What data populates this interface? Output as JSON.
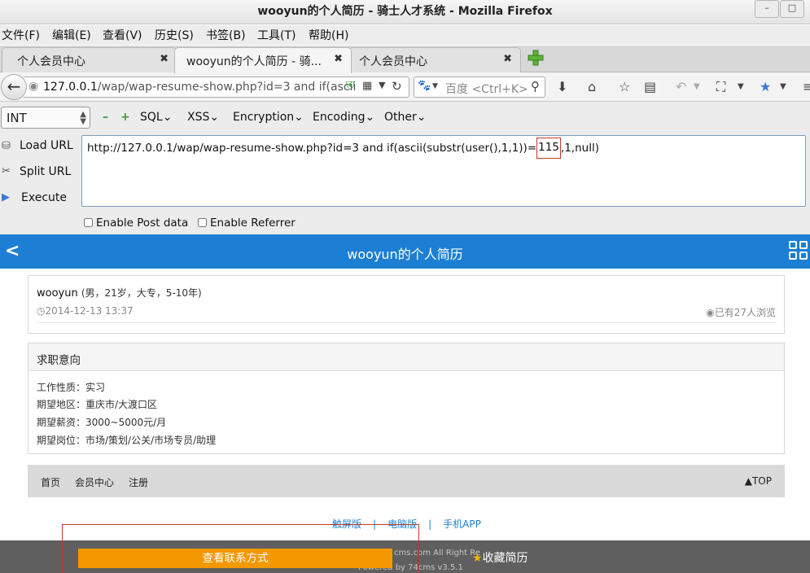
{
  "window": {
    "title": "wooyun的个人简历 - 骑士人才系统 - Mozilla Firefox",
    "minimize": "–",
    "maximize": "□"
  },
  "menu": [
    "文件(F)",
    "编辑(E)",
    "查看(V)",
    "历史(S)",
    "书签(B)",
    "工具(T)",
    "帮助(H)"
  ],
  "tabs": [
    {
      "label": "个人会员中心",
      "close": "✖"
    },
    {
      "label": "wooyun的个人简历 - 骑...",
      "close": "✖"
    },
    {
      "label": "个人会员中心",
      "close": "✖"
    }
  ],
  "nav": {
    "url_host": "127.0.0.1",
    "url_path": "/wap/wap-resume-show.php?id=3 and if(ascii",
    "search_placeholder": "百度 <Ctrl+K>"
  },
  "hackbar": {
    "select_value": "INT",
    "minus": "–",
    "plus": "+",
    "menus": [
      "SQL",
      "XSS",
      "Encryption",
      "Encoding",
      "Other"
    ],
    "load_url": "Load URL",
    "split_url": "Split URL",
    "execute": "Execute",
    "url_before": "http://127.0.0.1/wap/wap-resume-show.php?id=3 and if(ascii(substr(user(),1,1))=",
    "url_highlight": "115",
    "url_after": ",1,null)",
    "enable_post": "Enable Post data",
    "enable_referrer": "Enable Referrer"
  },
  "page": {
    "header_title": "wooyun的个人简历",
    "name": "wooyun",
    "details": "(男，21岁，大专，5-10年)",
    "date": "2014-12-13 13:37",
    "views": "已有27人浏览",
    "section_title": "求职意向",
    "rows": [
      "工作性质：实习",
      "期望地区：重庆市/大渡口区",
      "期望薪资：3000~5000元/月",
      "期望岗位：市场/策划/公关/市场专员/助理"
    ],
    "footer_links": [
      "首页",
      "会员中心",
      "注册"
    ],
    "top_link": "▲TOP",
    "version_links": [
      "触屏版",
      "电脑版",
      "手机APP"
    ],
    "copyright": "cms.com All Right Re",
    "powered": "Powered by 74cms v3.5.1",
    "contact_button": "查看联系方式",
    "favorite_button": "收藏简历"
  }
}
